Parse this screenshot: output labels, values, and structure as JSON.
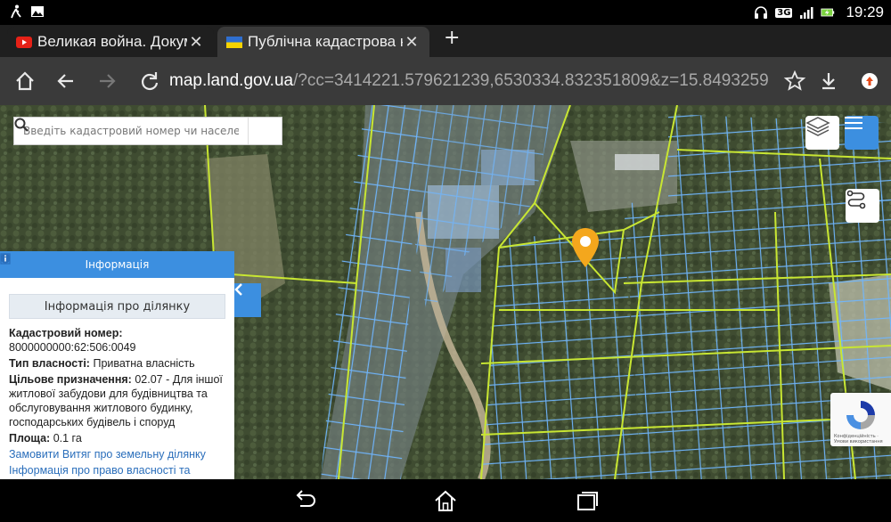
{
  "status": {
    "time": "19:29",
    "network": "3G"
  },
  "tabs": [
    {
      "title": "Великая война. Докум",
      "icon": "youtube-icon"
    },
    {
      "title": "Публічна кадастрова к",
      "icon": "ukraine-flag-icon"
    }
  ],
  "address": {
    "host": "map.land.gov.ua",
    "rest": "/?cc=3414221.579621239,6530334.832351809&z=15.8493259"
  },
  "search": {
    "placeholder": "Введіть кадастровий номер чи населений пункт"
  },
  "panel": {
    "header": "Інформація",
    "subheader": "Інформація про ділянку",
    "cadastral_label": "Кадастровий номер:",
    "cadastral_value": "8000000000:62:506:0049",
    "ownership_label": "Тип власності:",
    "ownership_value": "Приватна власність",
    "purpose_label": "Цільове призначення:",
    "purpose_value": "02.07 - Для іншої житлової забудови для будівництва та обслуговування житлового будинку, господарських будівель і споруд",
    "area_label": "Площа:",
    "area_value": "0.1 га",
    "link_extract": "Замовити Витяг про земельну ділянку",
    "link_rights": "Інформація про право власності та"
  },
  "recaptcha": {
    "text": "Конфіденційність · Умови використання"
  },
  "colors": {
    "accent": "#3c8fe0",
    "parcel_line": "#6fb6ff",
    "boundary_line": "#c8e632",
    "marker": "#f4a71d"
  }
}
